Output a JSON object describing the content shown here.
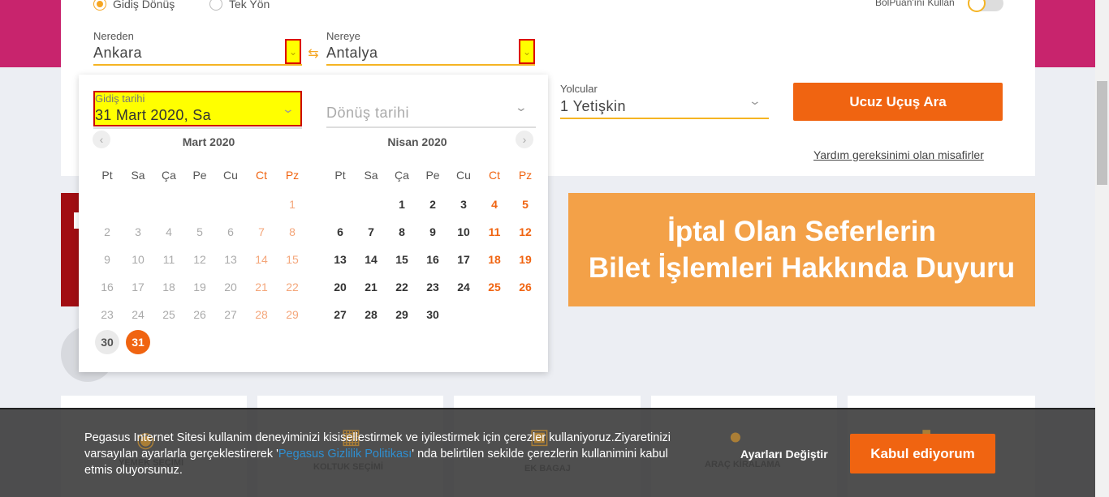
{
  "trip_type": {
    "round_trip_label": "Gidiş Dönüş",
    "one_way_label": "Tek Yön"
  },
  "bolpuan_label": "BolPuan'ını Kullan",
  "origin": {
    "label": "Nereden",
    "value": "Ankara"
  },
  "destination": {
    "label": "Nereye",
    "value": "Antalya"
  },
  "swap_icon": "⇆",
  "departure": {
    "label": "Gidiş tarihi",
    "value": "31 Mart 2020, Sa"
  },
  "return": {
    "placeholder": "Dönüş tarihi"
  },
  "passengers": {
    "label": "Yolcular",
    "value": "1 Yetişkin"
  },
  "search_button": "Ucuz Uçuş Ara",
  "help_link": "Yardım gereksinimi olan misafirler",
  "announcement": {
    "line1": "İptal Olan Seferlerin",
    "line2": "Bilet İşlemleri Hakkında Duyuru"
  },
  "calendar": {
    "weekdays": [
      "Pt",
      "Sa",
      "Ça",
      "Pe",
      "Cu",
      "Ct",
      "Pz"
    ],
    "month1": {
      "title": "Mart 2020",
      "weeks": [
        [
          "",
          "",
          "",
          "",
          "",
          "",
          "1"
        ],
        [
          "2",
          "3",
          "4",
          "5",
          "6",
          "7",
          "8"
        ],
        [
          "9",
          "10",
          "11",
          "12",
          "13",
          "14",
          "15"
        ],
        [
          "16",
          "17",
          "18",
          "19",
          "20",
          "21",
          "22"
        ],
        [
          "23",
          "24",
          "25",
          "26",
          "27",
          "28",
          "29"
        ],
        [
          "30",
          "31",
          "",
          "",
          "",
          "",
          ""
        ]
      ]
    },
    "month2": {
      "title": "Nisan 2020",
      "weeks": [
        [
          "",
          "",
          "1",
          "2",
          "3",
          "4",
          "5"
        ],
        [
          "6",
          "7",
          "8",
          "9",
          "10",
          "11",
          "12"
        ],
        [
          "13",
          "14",
          "15",
          "16",
          "17",
          "18",
          "19"
        ],
        [
          "20",
          "21",
          "22",
          "23",
          "24",
          "25",
          "26"
        ],
        [
          "27",
          "28",
          "29",
          "30",
          "",
          "",
          ""
        ]
      ]
    },
    "today": "30",
    "selected": "31"
  },
  "services": [
    {
      "label": "YEMEK SEÇİMİ",
      "icon": "meal-icon"
    },
    {
      "label": "KOLTUK SEÇİMİ",
      "icon": "seat-icon"
    },
    {
      "label": "EK BAGAJ",
      "icon": "baggage-icon"
    },
    {
      "label": "ARAÇ KİRALAMA",
      "icon": "car-icon"
    },
    {
      "label": "",
      "icon": "service-icon"
    }
  ],
  "cookie": {
    "text_before": "Pegasus Internet Sitesi kullanim deneyiminizi kisisellestirmek ve iyilestirmek için çerezler kullaniyoruz.Ziyaretinizi varsayılan ayarlarla gerçeklestirerek '",
    "link": "Pegasus Gizlilik Politikası",
    "text_after": "' nda belirtilen sekilde çerezlerin kullanimini kabul etmis oluyorsunuz.",
    "settings_label": "Ayarları Değiştir",
    "accept_label": "Kabul ediyorum"
  },
  "colors": {
    "brand_pink": "#c8246d",
    "accent_orange": "#f06411",
    "underline_yellow": "#f5b423",
    "banner_orange": "#f3a148",
    "banner_red": "#a10d12"
  }
}
